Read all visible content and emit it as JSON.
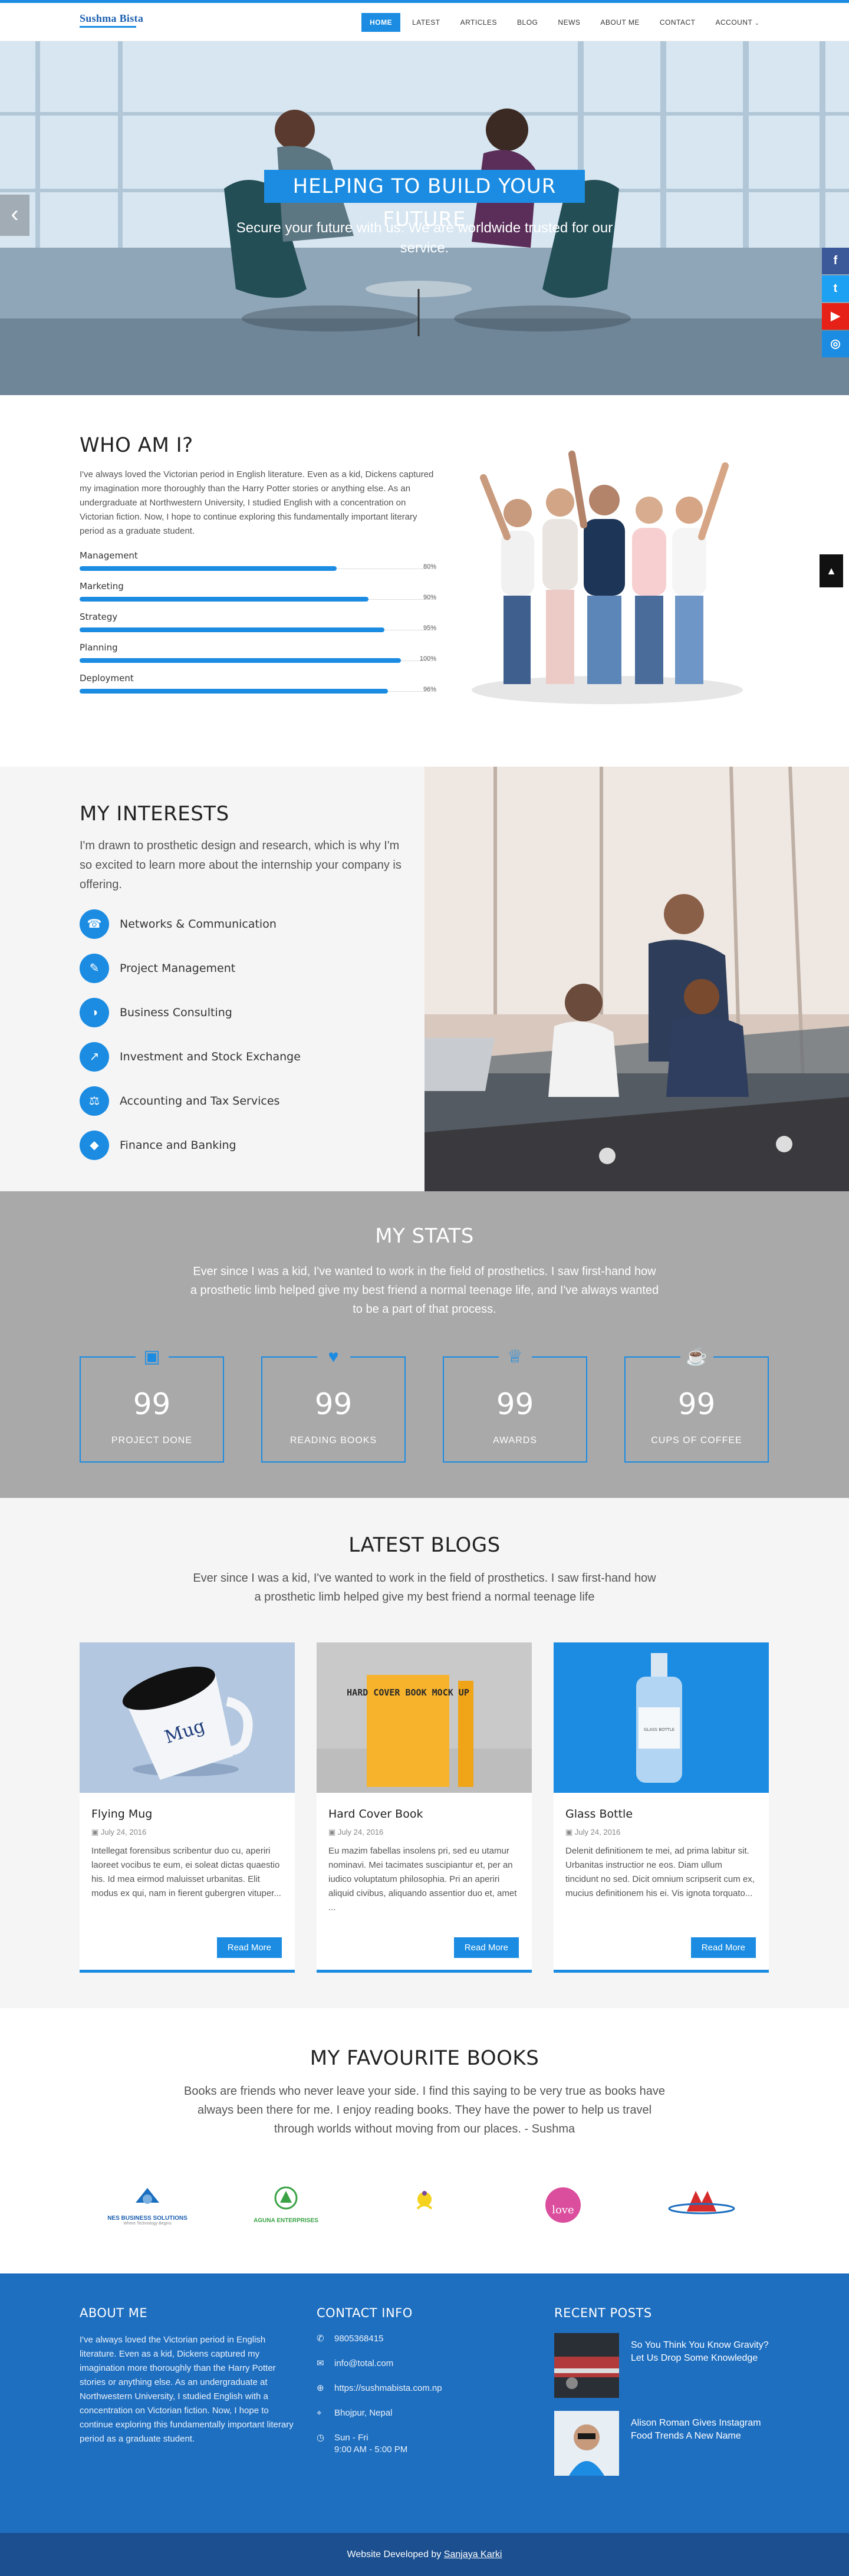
{
  "header": {
    "logo_name": "Sushma Bista",
    "nav": [
      "HOME",
      "LATEST",
      "ARTICLES",
      "BLOG",
      "NEWS",
      "ABOUT ME",
      "CONTACT",
      "ACCOUNT"
    ]
  },
  "hero": {
    "title": "HELPING TO BUILD YOUR FUTURE",
    "subtitle": "Secure your future with us. We are worldwide trusted for our service.",
    "prev_arrow": "‹"
  },
  "social": [
    "f",
    "t",
    "▶",
    "◎"
  ],
  "about": {
    "title": "WHO AM I?",
    "text": "I've always loved the Victorian period in English literature. Even as a kid, Dickens captured my imagination more thoroughly than the Harry Potter stories or anything else. As an undergraduate at Northwestern University, I studied English with a concentration on Victorian fiction. Now, I hope to continue exploring this fundamentally important literary period as a graduate student.",
    "skills": [
      {
        "name": "Management",
        "pct_label": "80%",
        "value": 80
      },
      {
        "name": "Marketing",
        "pct_label": "90%",
        "value": 90
      },
      {
        "name": "Strategy",
        "pct_label": "95%",
        "value": 95
      },
      {
        "name": "Planning",
        "pct_label": "100%",
        "value": 100
      },
      {
        "name": "Deployment",
        "pct_label": "96%",
        "value": 96
      }
    ]
  },
  "interests": {
    "title": "MY INTERESTS",
    "desc": "I'm drawn to prosthetic design and research, which is why I'm so excited to learn more about the internship your company is offering.",
    "items": [
      {
        "label": "Networks & Communication",
        "icon": "headset-icon"
      },
      {
        "label": "Project Management",
        "icon": "pencil-icon"
      },
      {
        "label": "Business Consulting",
        "icon": "pie-chart-icon"
      },
      {
        "label": "Investment and Stock Exchange",
        "icon": "line-chart-icon"
      },
      {
        "label": "Accounting and Tax Services",
        "icon": "balance-icon"
      },
      {
        "label": "Finance and Banking",
        "icon": "diamond-icon"
      }
    ]
  },
  "stats": {
    "title": "MY STATS",
    "desc": "Ever since I was a kid, I've wanted to work in the field of prosthetics. I saw first-hand how a prosthetic limb helped give my best friend a normal teenage life, and I've always wanted to be a part of that process.",
    "items": [
      {
        "num": "99",
        "label": "PROJECT DONE",
        "icon": "briefcase-icon"
      },
      {
        "num": "99",
        "label": "READING BOOKS",
        "icon": "heart-icon"
      },
      {
        "num": "99",
        "label": "AWARDS",
        "icon": "trophy-icon"
      },
      {
        "num": "99",
        "label": "CUPS OF COFFEE",
        "icon": "coffee-icon"
      }
    ]
  },
  "blogs": {
    "title": "LATEST BLOGS",
    "desc": "Ever since I was a kid, I've wanted to work in the field of prosthetics. I saw first-hand how a prosthetic limb helped give my best friend a normal teenage life",
    "cards": [
      {
        "title": "Flying Mug",
        "date": "July 24, 2016",
        "text": "Intellegat forensibus scribentur duo cu, aperiri laoreet vocibus te eum, ei soleat dictas quaestio his. Id mea eirmod maluisset urbanitas. Elit modus ex qui, nam in fierent gubergren vituper...",
        "button": "Read More",
        "mug_text": "Mug"
      },
      {
        "title": "Hard Cover Book",
        "date": "July 24, 2016",
        "text": "Eu mazim fabellas insolens pri, sed eu utamur nominavi. Mei tacimates suscipiantur et, per an iudico voluptatum philosophia. Pri an aperiri aliquid civibus, aliquando assentior duo et, amet ...",
        "button": "Read More",
        "book_text": "HARD COVER BOOK MOCK UP"
      },
      {
        "title": "Glass Bottle",
        "date": "July 24, 2016",
        "text": "Delenit definitionem te mei, ad prima labitur sit. Urbanitas instructior ne eos. Diam ullum tincidunt no sed. Dicit omnium scripserit cum ex, mucius definitionem his ei. Vis ignota torquato...",
        "button": "Read More",
        "bottle_text": "GLASS BOTTLE"
      }
    ]
  },
  "books": {
    "title": "MY FAVOURITE BOOKS",
    "desc": "Books are friends who never leave your side. I find this saying to be very true as books have always been there for me. I enjoy reading books. They have the power to help us travel through worlds without moving from our places. - Sushma",
    "brands": [
      {
        "name": "NES BUSINESS SOLUTIONS",
        "tag": "Where Technology Begins"
      },
      {
        "name": "AGUNA ENTERPRISES",
        "tag": ""
      },
      {
        "name": "",
        "tag": ""
      },
      {
        "name": "love",
        "tag": ""
      },
      {
        "name": "",
        "tag": ""
      }
    ]
  },
  "footer": {
    "about_title": "ABOUT ME",
    "about_text": "I've always loved the Victorian period in English literature. Even as a kid, Dickens captured my imagination more thoroughly than the Harry Potter stories or anything else. As an undergraduate at Northwestern University, I studied English with a concentration on Victorian fiction. Now, I hope to continue exploring this fundamentally important literary period as a graduate student.",
    "contact_title": "CONTACT INFO",
    "contacts": [
      {
        "icon": "phone-icon",
        "glyph": "✆",
        "line1": "9805368415",
        "line2": ""
      },
      {
        "icon": "mail-icon",
        "glyph": "✉",
        "line1": "info@total.com",
        "line2": ""
      },
      {
        "icon": "globe-icon",
        "glyph": "⊕",
        "line1": "https://sushmabista.com.np",
        "line2": ""
      },
      {
        "icon": "location-icon",
        "glyph": "⌖",
        "line1": "Bhojpur, Nepal",
        "line2": ""
      },
      {
        "icon": "clock-icon",
        "glyph": "◷",
        "line1": "Sun - Fri",
        "line2": "9:00 AM - 5:00 PM"
      }
    ],
    "posts_title": "RECENT POSTS",
    "posts": [
      {
        "title": "So You Think You Know Gravity? Let Us Drop Some Knowledge"
      },
      {
        "title": "Alison Roman Gives Instagram Food Trends A New Name"
      }
    ],
    "credit_prefix": "Website Developed by ",
    "credit_name": "Sanjaya Karki"
  },
  "colors": {
    "accent": "#1b8ce2",
    "footer": "#1f6fc0",
    "stats_bg": "#a9a9a9"
  }
}
